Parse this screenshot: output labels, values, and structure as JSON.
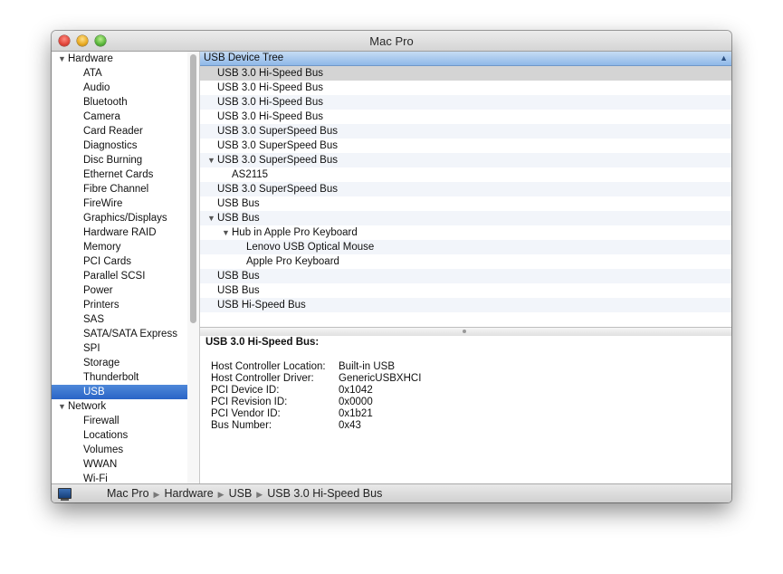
{
  "window": {
    "title": "Mac Pro"
  },
  "sidebar": {
    "sections": [
      {
        "label": "Hardware",
        "items": [
          "ATA",
          "Audio",
          "Bluetooth",
          "Camera",
          "Card Reader",
          "Diagnostics",
          "Disc Burning",
          "Ethernet Cards",
          "Fibre Channel",
          "FireWire",
          "Graphics/Displays",
          "Hardware RAID",
          "Memory",
          "PCI Cards",
          "Parallel SCSI",
          "Power",
          "Printers",
          "SAS",
          "SATA/SATA Express",
          "SPI",
          "Storage",
          "Thunderbolt",
          "USB"
        ]
      },
      {
        "label": "Network",
        "items": [
          "Firewall",
          "Locations",
          "Volumes",
          "WWAN",
          "Wi-Fi"
        ]
      }
    ],
    "selected": "USB"
  },
  "tree": {
    "header": "USB Device Tree",
    "rows": [
      {
        "label": "USB 3.0 Hi-Speed Bus"
      },
      {
        "label": "USB 3.0 Hi-Speed Bus"
      },
      {
        "label": "USB 3.0 Hi-Speed Bus"
      },
      {
        "label": "USB 3.0 Hi-Speed Bus"
      },
      {
        "label": "USB 3.0 SuperSpeed Bus"
      },
      {
        "label": "USB 3.0 SuperSpeed Bus"
      },
      {
        "label": "USB 3.0 SuperSpeed Bus"
      },
      {
        "label": "AS2115"
      },
      {
        "label": "USB 3.0 SuperSpeed Bus"
      },
      {
        "label": "USB Bus"
      },
      {
        "label": "USB Bus"
      },
      {
        "label": "Hub in Apple Pro Keyboard"
      },
      {
        "label": "Lenovo USB Optical Mouse"
      },
      {
        "label": "Apple Pro Keyboard"
      },
      {
        "label": "USB Bus"
      },
      {
        "label": "USB Bus"
      },
      {
        "label": "USB Hi-Speed Bus"
      }
    ]
  },
  "detail": {
    "title": "USB 3.0 Hi-Speed Bus:",
    "fields": [
      {
        "key": "Host Controller Location:",
        "value": "Built-in USB"
      },
      {
        "key": "Host Controller Driver:",
        "value": "GenericUSBXHCI"
      },
      {
        "key": "PCI Device ID:",
        "value": "0x1042"
      },
      {
        "key": "PCI Revision ID:",
        "value": "0x0000"
      },
      {
        "key": "PCI Vendor ID:",
        "value": "0x1b21"
      },
      {
        "key": "Bus Number:",
        "value": "0x43"
      }
    ]
  },
  "breadcrumb": [
    "Mac Pro",
    "Hardware",
    "USB",
    "USB 3.0 Hi-Speed Bus"
  ]
}
